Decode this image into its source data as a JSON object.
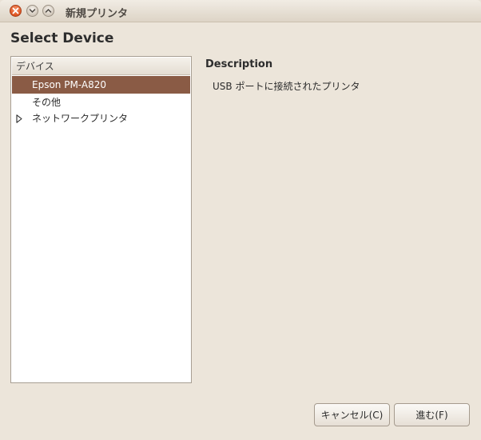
{
  "window": {
    "title": "新規プリンタ"
  },
  "page": {
    "heading": "Select Device"
  },
  "device_list": {
    "column_header": "デバイス",
    "items": [
      {
        "label": "Epson PM-A820",
        "selected": true,
        "expandable": false
      },
      {
        "label": "その他",
        "selected": false,
        "expandable": false
      },
      {
        "label": "ネットワークプリンタ",
        "selected": false,
        "expandable": true
      }
    ]
  },
  "description": {
    "title": "Description",
    "text": "USB ポートに接続されたプリンタ"
  },
  "buttons": {
    "cancel": "キャンセル(C)",
    "forward": "進む(F)"
  },
  "colors": {
    "selection": "#8a5b45",
    "close_button": "#e0531f",
    "window_bg": "#ece5da"
  }
}
